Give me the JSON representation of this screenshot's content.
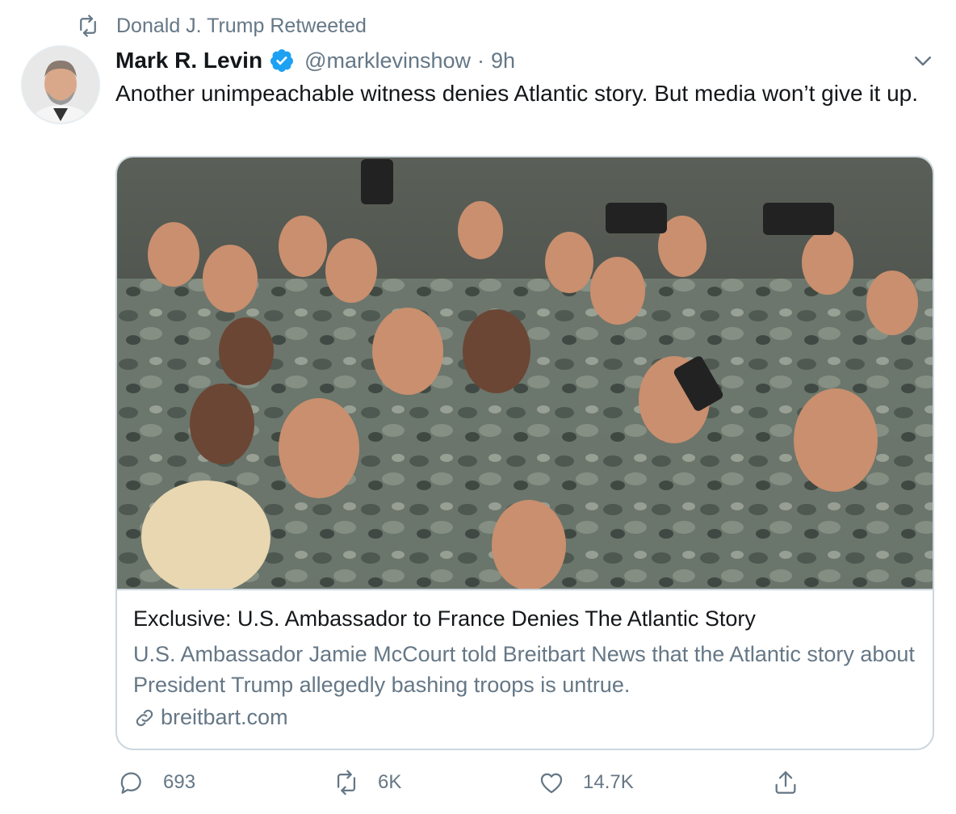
{
  "retweet_banner": {
    "text": "Donald J. Trump Retweeted",
    "icon": "retweet-icon"
  },
  "tweet": {
    "author_name": "Mark R. Levin",
    "verified_icon": "verified-badge-icon",
    "handle": "@marklevinshow",
    "separator": "·",
    "time": "9h",
    "text": "Another unimpeachable witness denies Atlantic story.  But media won’t give it up."
  },
  "card": {
    "title": "Exclusive: U.S. Ambassador to France Denies The Atlantic Story",
    "description": "U.S. Ambassador Jamie McCourt told Breitbart News that the Atlantic story about President Trump allegedly bashing troops is untrue.",
    "domain": "breitbart.com",
    "link_icon": "link-icon"
  },
  "actions": {
    "reply_count": "693",
    "retweet_count": "6K",
    "like_count": "14.7K"
  },
  "colors": {
    "verified": "#1da1f2",
    "secondary_text": "#657786",
    "border": "#ccd6dd"
  }
}
